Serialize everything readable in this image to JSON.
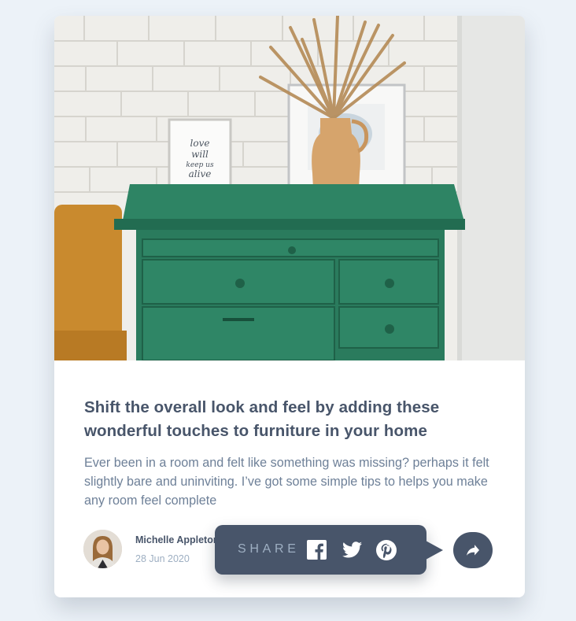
{
  "article": {
    "image_alt": "Green wooden drawers with a vase of dried grass and picture frames",
    "title": "Shift the overall look and feel by adding these wonderful touches to furniture in your home",
    "description": "Ever been in a room and felt like something was missing? perhaps it felt slightly bare and uninviting. I’ve got some simple tips to helps you make any room feel complete"
  },
  "author": {
    "name": "Michelle Appleton",
    "date": "28 Jun 2020"
  },
  "share": {
    "label": "SHARE",
    "networks": [
      {
        "name": "Facebook",
        "icon": "facebook-icon"
      },
      {
        "name": "Twitter",
        "icon": "twitter-icon"
      },
      {
        "name": "Pinterest",
        "icon": "pinterest-icon"
      }
    ],
    "button_icon": "share-arrow-icon",
    "popup_open": true
  },
  "colors": {
    "page_bg": "#ecf2f8",
    "card_bg": "#ffffff",
    "dark_blue": "#48556a",
    "desaturated_blue": "#6e8098",
    "grayish_blue": "#9eafc2"
  }
}
